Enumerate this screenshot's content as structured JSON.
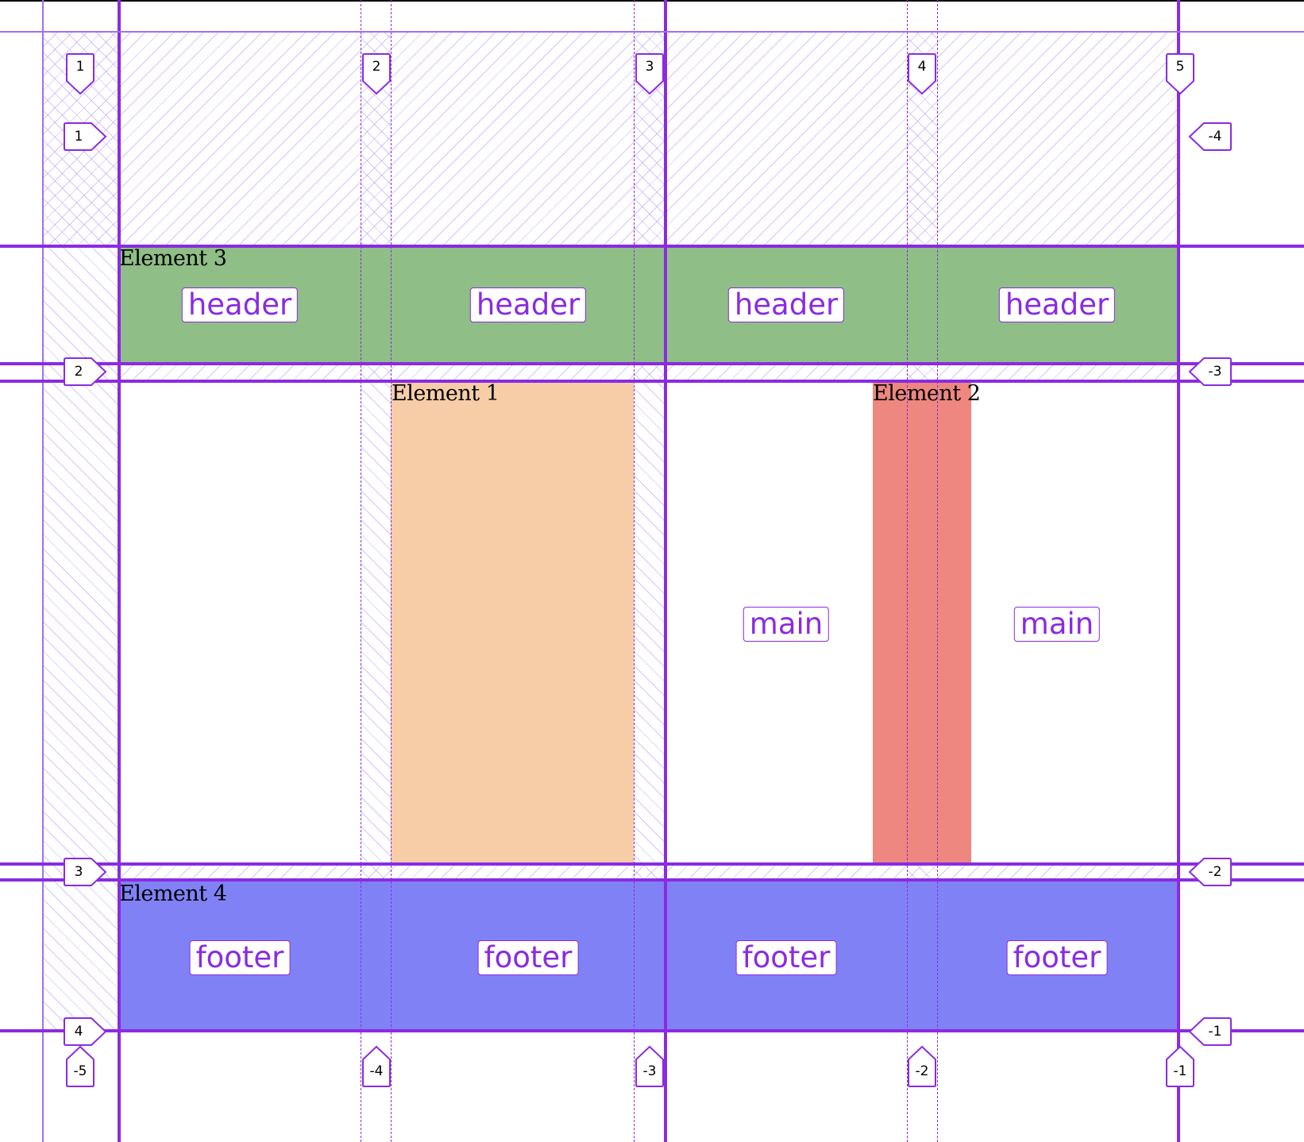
{
  "elements": [
    {
      "label": "Element 3",
      "color": "#8fbe86",
      "row": [
        2,
        3
      ],
      "col": [
        1,
        5
      ]
    },
    {
      "label": "Element 1",
      "color": "#f7cda8",
      "row": [
        3,
        4
      ],
      "col": [
        2,
        3
      ]
    },
    {
      "label": "Element 2",
      "color": "#ee8780",
      "row": [
        3,
        4
      ],
      "col": [
        4,
        5
      ]
    },
    {
      "label": "Element 4",
      "color": "#8181f6",
      "row": [
        4,
        5
      ],
      "col": [
        1,
        5
      ]
    }
  ],
  "area_names": [
    {
      "text": "header",
      "row": 0,
      "col": 0
    },
    {
      "text": "header",
      "row": 0,
      "col": 1
    },
    {
      "text": "header",
      "row": 0,
      "col": 2
    },
    {
      "text": "header",
      "row": 0,
      "col": 3
    },
    {
      "text": "main",
      "row": 1,
      "col": 2
    },
    {
      "text": "main",
      "row": 1,
      "col": 3
    },
    {
      "text": "footer",
      "row": 2,
      "col": 0
    },
    {
      "text": "footer",
      "row": 2,
      "col": 1
    },
    {
      "text": "footer",
      "row": 2,
      "col": 2
    },
    {
      "text": "footer",
      "row": 2,
      "col": 3
    }
  ],
  "column_numbers": {
    "positive": [
      "1",
      "2",
      "3",
      "4",
      "5"
    ],
    "negative": [
      "-5",
      "-4",
      "-3",
      "-2",
      "-1"
    ]
  },
  "row_numbers": {
    "positive": [
      "1",
      "2",
      "3",
      "4"
    ],
    "negative": [
      "-4",
      "-3",
      "-2",
      "-1"
    ]
  },
  "colors": {
    "grid_line": "#8a2be2",
    "badge_border": "#8a2be2",
    "hatch": "#b894f0"
  }
}
